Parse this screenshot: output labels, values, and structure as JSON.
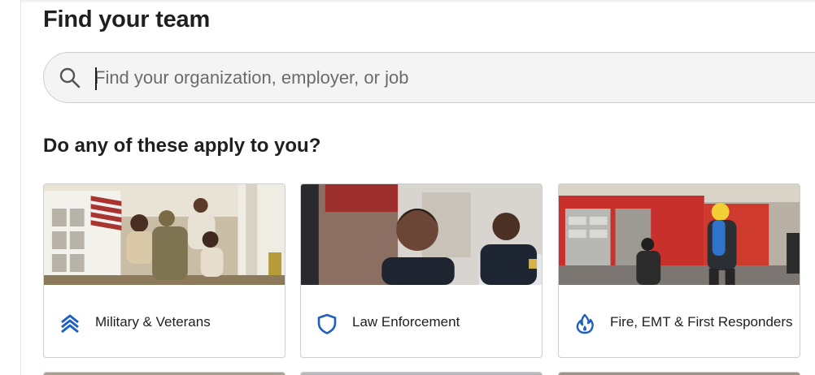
{
  "header": {
    "title": "Find your team"
  },
  "search": {
    "placeholder": "Find your organization, employer, or job",
    "value": ""
  },
  "section": {
    "title": "Do any of these apply to you?"
  },
  "cards": [
    {
      "label": "Military & Veterans",
      "icon": "chevron-rank-icon",
      "image": "family-reunion-photo"
    },
    {
      "label": "Law Enforcement",
      "icon": "shield-icon",
      "image": "police-officers-photo"
    },
    {
      "label": "Fire, EMT & First Responders",
      "icon": "flame-icon",
      "image": "firefighters-truck-photo"
    }
  ],
  "colors": {
    "accent": "#1f5fbf",
    "text": "#1f1f1f",
    "placeholder": "#6b6b6b",
    "border": "#cfcfcf",
    "search_bg": "#f4f4f4"
  }
}
